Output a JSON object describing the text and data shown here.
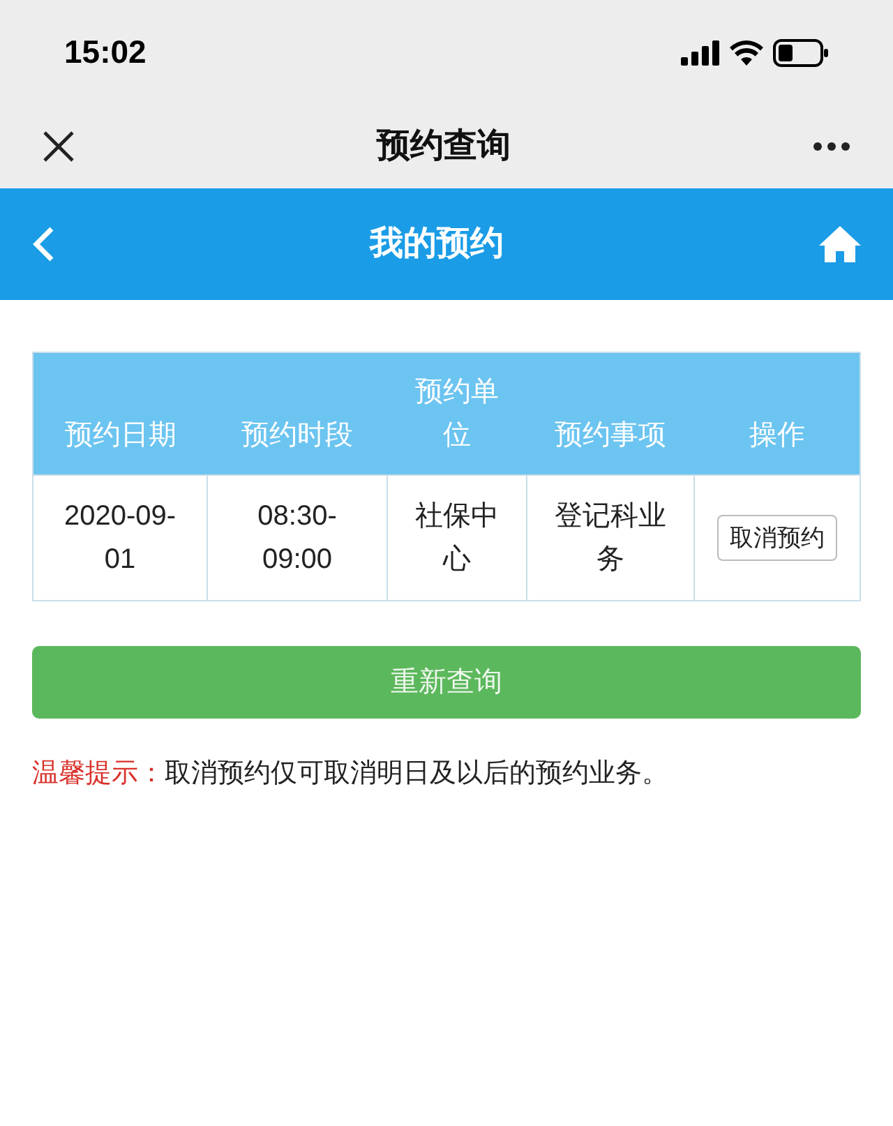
{
  "status_bar": {
    "time": "15:02"
  },
  "nav_bar": {
    "title": "预约查询"
  },
  "header": {
    "title": "我的预约"
  },
  "table": {
    "columns": [
      "预约日期",
      "预约时段",
      "预约单位",
      "预约事项",
      "操作"
    ],
    "rows": [
      {
        "cells": [
          "2020-09-01",
          "08:30-09:00",
          "社保中心",
          "登记科业务"
        ],
        "action": "取消预约"
      }
    ]
  },
  "requery_button": "重新查询",
  "tip": {
    "label": "温馨提示：",
    "text": "取消预约仅可取消明日及以后的预约业务。"
  }
}
